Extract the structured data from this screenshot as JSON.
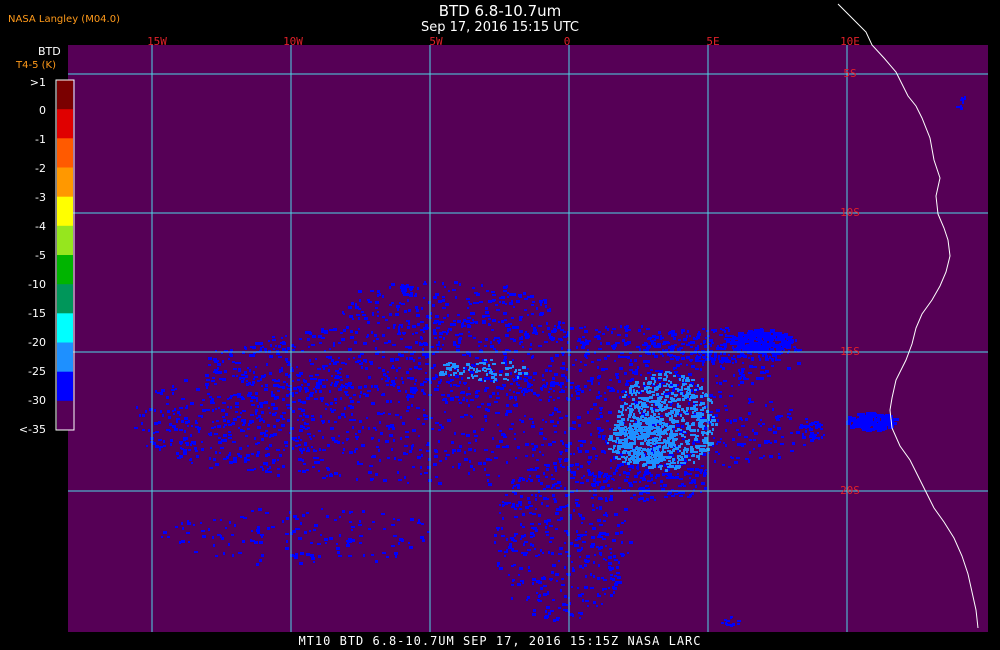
{
  "header": {
    "credit": "NASA Langley (M04.0)",
    "title": "BTD 6.8-10.7um",
    "subtitle": "Sep 17, 2016 15:15 UTC"
  },
  "legend": {
    "title": "BTD",
    "units": "T4-5 (K)",
    "labels": [
      ">1",
      "0",
      "-1",
      "-2",
      "-3",
      "-4",
      "-5",
      "-10",
      "-15",
      "-20",
      "-25",
      "-30",
      "<-35"
    ],
    "colors": [
      "#7a0000",
      "#e00000",
      "#ff5a00",
      "#ff9800",
      "#ffff00",
      "#96e61e",
      "#00b400",
      "#00965a",
      "#00ffff",
      "#1e90ff",
      "#0000ff",
      "#560056"
    ]
  },
  "map": {
    "longitude_labels": [
      "15W",
      "10W",
      "5W",
      "0",
      "5E",
      "10E"
    ],
    "latitude_labels": [
      "5S",
      "10S",
      "15S",
      "20S"
    ],
    "colors": {
      "background": "#560056",
      "grid": "#4fd6e6",
      "coast": "#ffffff",
      "lon_label": "#e0202a",
      "lat_label": "#e0202a",
      "band_mid": "#0000ff",
      "band_high": "#1e90ff"
    }
  },
  "footer": {
    "text": "MT10  BTD 6.8-10.7UM   SEP 17, 2016 15:15Z  NASA LARC"
  }
}
